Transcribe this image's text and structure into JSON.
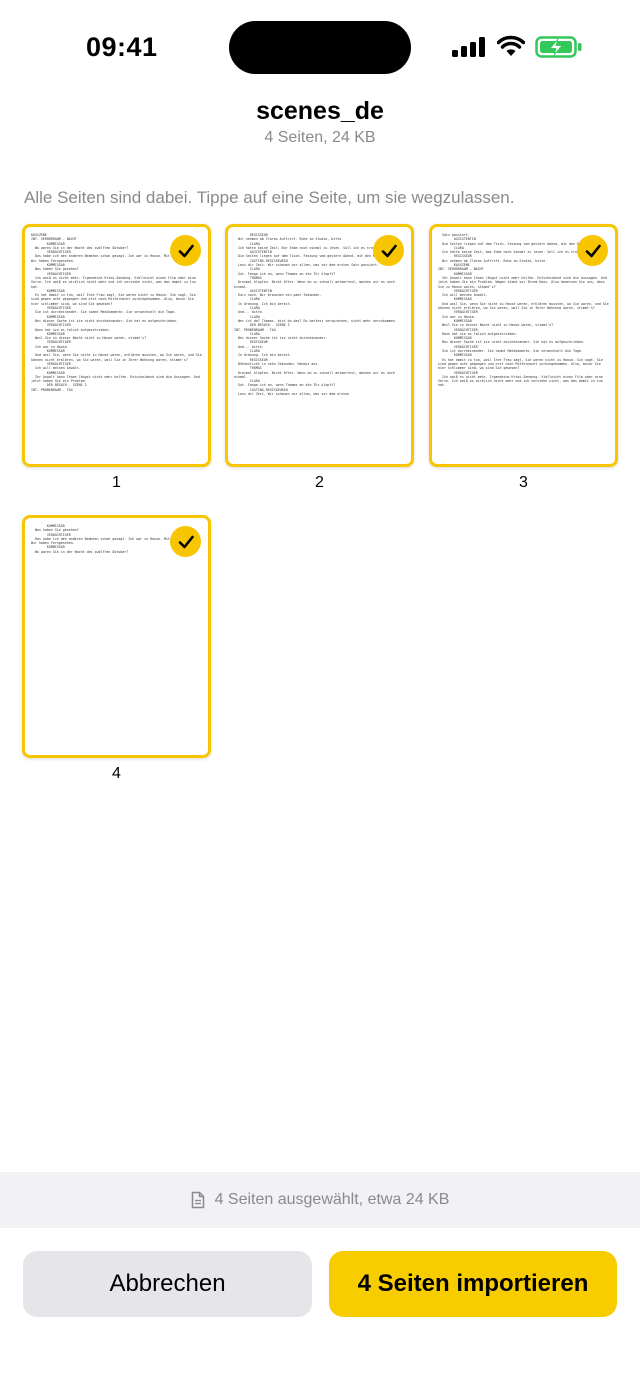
{
  "status_bar": {
    "time": "09:41",
    "icons": [
      "cellular-signal-icon",
      "wifi-icon",
      "battery-charging-icon"
    ],
    "battery_color": "#34c759"
  },
  "header": {
    "title": "scenes_de",
    "subtitle": "4 Seiten, 24 KB"
  },
  "hint": "Alle Seiten sind dabei. Tippe auf eine Seite, um sie wegzulassen.",
  "pages": [
    {
      "number": "1",
      "selected": true,
      "text": "KOSSZENE\nINT. VERHÖRRAUM - NACHT\n        KOMMISSAR\n  Wo waren Sie in der Nacht des zwölften Oktober?\n        VERDÄCHTIGER\n  Das habe ich den anderen Beamten schon gesagt. Ich war zu Hause. Mit meiner Frau. Wir haben Ferngesehen.\n        KOMMISSAR\n  Was haben Sie gesehen?\n        VERDÄCHTIGER\n  Ich weiß es nicht mehr. Irgendeine Krimi-Sendung. Vielleicht einen Film oder eine Serie. Ich weiß es wirklich nicht mehr und ich verstehe nicht, was das damit zu tun hat.\n        KOMMISSAR\n  Es hat damit zu tun, weil Ihre Frau sagt, Sie waren nicht zu Hause. Sie sagt, Sie sind gegen acht gegangen und erst nach Mitternacht zurückgekommen. Also, bevor Sie hier schlimmer sind, wo sind Sie gewesen?\n        VERDÄCHTIGER\n  Sie ist durcheinander. Sie nimmt Medikamente. Sie verwechselt die Tage.\n        KOMMISSAR\n  Bei dieser Sache ist sie nicht durcheinander. Sie hat es aufgeschrieben.\n        VERDÄCHTIGER\n  Dann hat sie es falsch aufgeschrieben.\n        KOMMISSAR\n  Weil Sie in dieser Nacht nicht zu Hause waren, stimmt's?\n        VERDÄCHTIGER\n  Ich war zu Hause.\n        KOMMISSAR\n  Und weil Sie, wenn Sie nicht zu Hause waren, erklären mussten, wo Sie waren, und Sie können nicht erklären, wo Sie waren, weil Sie in Ihrer Wohnung waren, stimmt's?\n        VERDÄCHTIGER\n  Ich will meinen Anwalt.\n        KOMMISSAR\n  Ihr Anwalt kann Ihnen längst nicht mehr helfen. Entscheidend sind die Aussagen. Und jetzt haben Sie ein Problem.\n        DER BESUCH - SZENE 2\nINT. PROBENRAUM - TAG"
    },
    {
      "number": "2",
      "selected": true,
      "text": "        REGISSEUR\n  Wir nehmen ab Claras Auftritt. Ruhe im Studio, bitte.\n        CLARA\n  Ich hatte keine Zeit. Nur Ende noch einmal zu lesen. Soll ich es trotzdem spielen?\n        ASSISTENTIN\n  Die Seiten liegen auf dem Tisch. Fassung vom gestern Abend, mit den Kürzungen.\n        CASTING-REGISSEURIN\n  Lass dir Zeit. Wir schauen vor allem, was vor dem ersten Satz passiert.\n        CLARA\n  Gut. Fange ich an, wenn Thomas an die Tür klopft?\n        THOMAS\n  Dreimal klopfen. Nicht öfter. Wenn du zu schnell antwortest, machen wir es noch einmal.\n        ASSISTENTIN\n  Kurz noch. Wir brauchen ein paar Sekunden.\n        CLARA\n  In Ordnung. Ich bin bereit.\n        CLARA\n  Und... bitte.\n        CLARA\n  Wer ist da? Thomas, bist du das? Du hattest versprochen, nicht mehr herzukommen.\n        DER BESUCH - SZENE 3\nINT. PROBENRAUM - TAG\n        CLARA\n  Bei dieser Sache ist sie nicht durcheinander.\n        REGISSEUR\n  Und... bitte.\n        CLARA\n  In Ordnung. Ich bin bereit.\n        REGISSEUR\n  Bühnenlicht in zehn Sekunden. Handys aus.\n        THOMAS\n  Dreimal klopfen. Nicht öfter. Wenn du zu schnell antwortest, machen wir es noch einmal.\n        CLARA\n  Gut. Fange ich an, wenn Thomas an die Tür klopft?\n        CASTING-REGISSEURIN\n  Lass dir Zeit. Wir schauen vor allem, was vor dem ersten"
    },
    {
      "number": "3",
      "selected": true,
      "text": "  Satz passiert.\n        ASSISTENTIN\n  Die Seiten liegen auf dem Tisch. Fassung vom gestern Abend, mit den Kürzungen.\n        CLARA\n  Ich hatte keine Zeit, das Ende noch einmal zu lesen. Soll ich es trotzdem spielen?\n        REGISSEUR\n  Wir nehmen ab Claras Auftritt. Ruhe im Studio, bitte.\n        KOSSZENE\nINT. VERHÖRRAUM - NACHT\n        KOMMISSAR\n  Ihr Anwalt kann Ihnen längst nicht mehr helfen. Entscheidend sind die Aussagen. Und jetzt haben Sie ein Problem. Wagen stand vor Ihrem Haus. Also beweisen Sie uns, dass Sie zu Hause waren, stimmt's?\n        VERDÄCHTIGER\n  Ich will meinen Anwalt.\n        KOMMISSAR\n  Und weil Sie, wenn Sie nicht zu Hause waren, erklären mussten, wo Sie waren, und Sie können nicht erklären, wo Sie waren, weil Sie in Ihrer Wohnung waren, stimmt's?\n        VERDÄCHTIGER\n  Ich war zu Hause.\n        KOMMISSAR\n  Weil Sie in dieser Nacht nicht zu Hause waren, stimmt's?\n        VERDÄCHTIGER\n  Dann hat sie es falsch aufgeschrieben.\n        KOMMISSAR\n  Bei dieser Sache ist sie nicht durcheinander. Sie hat es aufgeschrieben.\n        VERDÄCHTIGER\n  Sie ist durcheinander. Sie nimmt Medikamente. Sie verwechselt die Tage.\n        KOMMISSAR\n  Es hat damit zu tun, weil Ihre Frau sagt, Sie waren nicht zu Hause. Sie sagt, Sie sind gegen acht gegangen und erst nach Mitternacht zurückgekommen. Also, bevor Sie hier schlimmer sind, wo sind Sie gewesen?\n        VERDÄCHTIGER\n  Ich weiß es nicht mehr. Irgendeine Krimi-Sendung. Vielleicht einen Film oder eine Serie. Ich weiß es wirklich nicht mehr und ich verstehe nicht, was das damit zu tun hat."
    },
    {
      "number": "4",
      "selected": true,
      "text": "        KOMMISSAR\n  Was haben Sie gesehen?\n        VERDÄCHTIGER\n  Das habe ich den anderen Beamten schon gesagt. Ich war zu Hause. Mit meiner Frau. Wir haben Ferngesehen.\n        KOMMISSAR\n  Wo waren Sie in der Nacht des zwölften Oktober?"
    }
  ],
  "summary": {
    "icon": "document-icon",
    "text": "4 Seiten ausgewählt, etwa 24 KB"
  },
  "actions": {
    "cancel_label": "Abbrechen",
    "import_label": "4 Seiten importieren",
    "accent_color": "#f8cd00"
  }
}
